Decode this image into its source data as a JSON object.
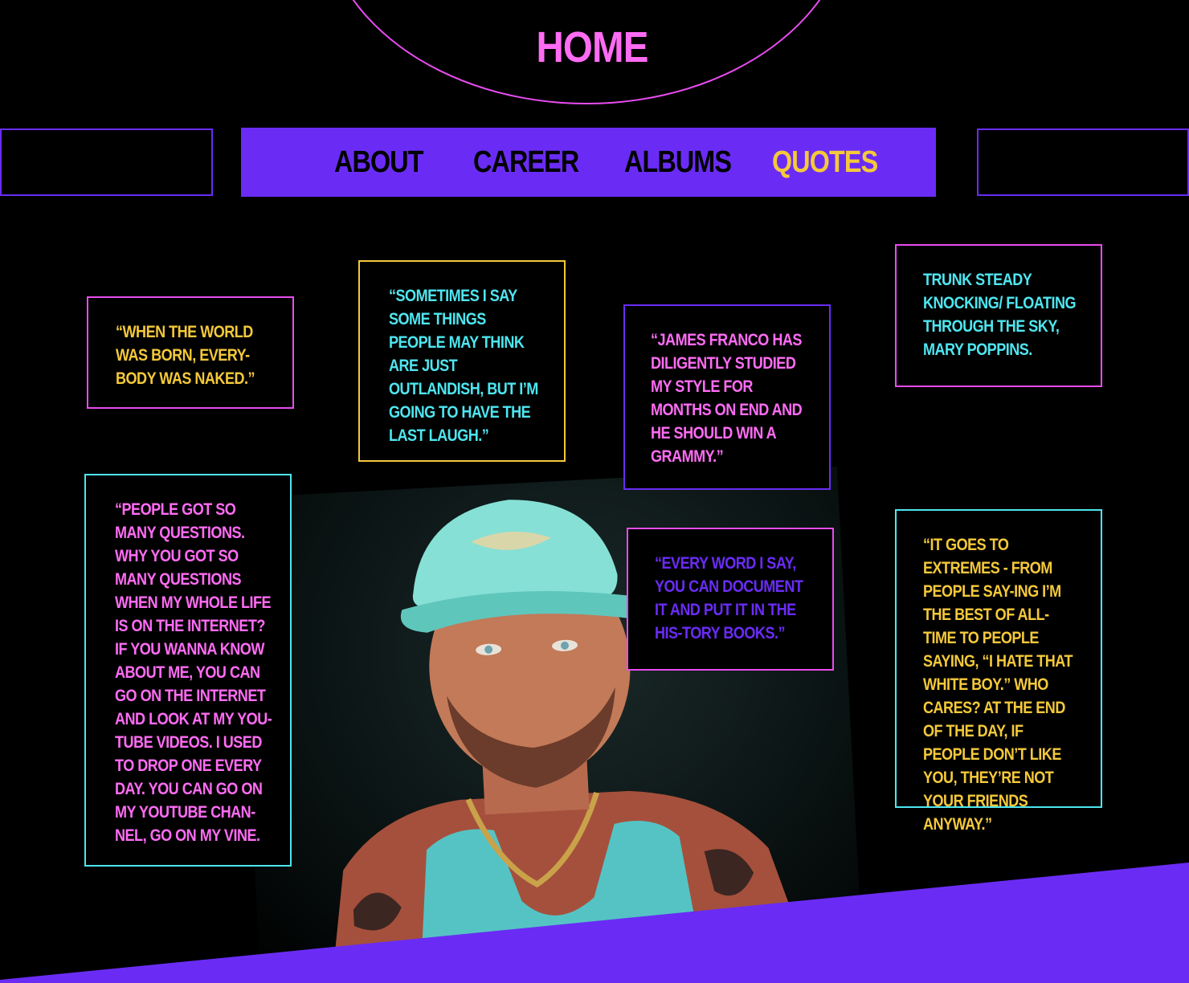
{
  "header": {
    "home_label": "HOME"
  },
  "nav": {
    "items": [
      {
        "label": "ABOUT",
        "active": false
      },
      {
        "label": "CAREER",
        "active": false
      },
      {
        "label": "ALBUMS",
        "active": false
      },
      {
        "label": "QUOTES",
        "active": true
      }
    ]
  },
  "quotes": [
    {
      "text": "“When the world was born, every-body was naked.”"
    },
    {
      "text": "“Sometimes I say some things people may think are just outlandish, but I’m going to have the last laugh.”"
    },
    {
      "text": "“James Franco has diligently studied my style for months on end and he should win a Grammy.”"
    },
    {
      "text": "Trunk steady knocking/ floating through the sky, Mary Poppins."
    },
    {
      "text": "“People got so many questions. Why you got so many questions when my whole life is on the internet? If you wanna know about me, you can go on the internet and look at my You-Tube videos. I used to drop one every day. You can go on my YouTube chan-nel, go on my Vine."
    },
    {
      "text": "“Every word I say, you can document it and put it in the his-tory books.”"
    },
    {
      "text": "“It goes to extremes - from people say-ing I’m the best of all-time to people saying, “I hate that white boy.” Who cares? At the end of the day, if people don’t like you, they’re not your friends anyway.”"
    }
  ],
  "colors": {
    "background": "#000000",
    "accent_purple": "#6a2cf5",
    "pink": "#ff6cf4",
    "yellow": "#f4c93a",
    "cyan": "#4ee6f0"
  }
}
